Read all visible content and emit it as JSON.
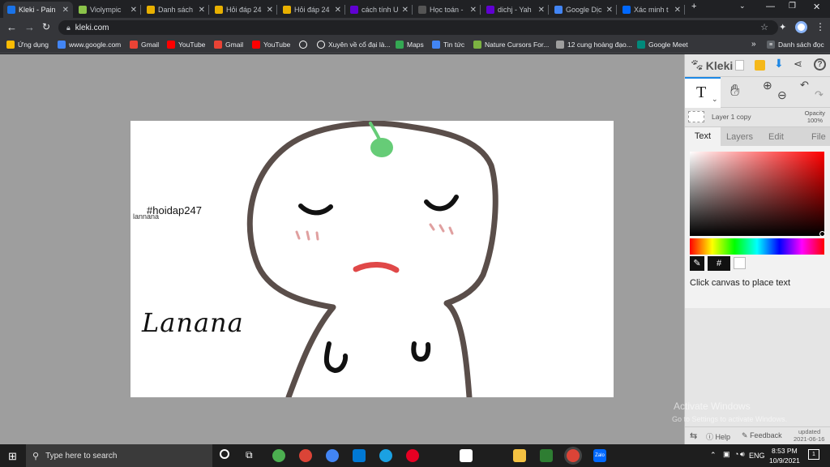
{
  "browser": {
    "tabs": [
      {
        "label": "Kleki - Pain",
        "icon": "kleki-icon",
        "color": "#1a73e8"
      },
      {
        "label": "Violympic",
        "icon": "violympic-icon",
        "color": "#8bc34a"
      },
      {
        "label": "Danh sách",
        "icon": "hoidap-icon",
        "color": "#e8b000"
      },
      {
        "label": "Hỏi đáp 24",
        "icon": "hoidap-icon",
        "color": "#e8b000"
      },
      {
        "label": "Hỏi đáp 24",
        "icon": "hoidap-icon",
        "color": "#e8b000"
      },
      {
        "label": "cách tính U",
        "icon": "yahoo-icon",
        "color": "#6001d2"
      },
      {
        "label": "Học toán -",
        "icon": "hoctoan-icon",
        "color": "#555555"
      },
      {
        "label": "dichj - Yah",
        "icon": "yahoo-icon",
        "color": "#6001d2"
      },
      {
        "label": "Google Dịc",
        "icon": "translate-icon",
        "color": "#4285f4"
      },
      {
        "label": "Xác minh t",
        "icon": "zalo-icon",
        "color": "#0068ff"
      }
    ],
    "url": "kleki.com",
    "bookmarks": [
      {
        "label": "Ứng dụng",
        "icon": "apps-icon",
        "color": "#fbbc04"
      },
      {
        "label": "www.google.com",
        "icon": "google-icon",
        "color": "#4285f4"
      },
      {
        "label": "Gmail",
        "icon": "gmail-icon",
        "color": "#ea4335"
      },
      {
        "label": "YouTube",
        "icon": "youtube-icon",
        "color": "#ff0000"
      },
      {
        "label": "Gmail",
        "icon": "gmail-icon",
        "color": "#ea4335"
      },
      {
        "label": "YouTube",
        "icon": "youtube-icon",
        "color": "#ff0000"
      },
      {
        "label": "",
        "icon": "globe-icon",
        "color": "#ffffff"
      },
      {
        "label": "Xuyên về cổ đại là...",
        "icon": "globe-icon",
        "color": "#ffffff"
      },
      {
        "label": "Maps",
        "icon": "maps-icon",
        "color": "#34a853"
      },
      {
        "label": "Tin tức",
        "icon": "news-icon",
        "color": "#4285f4"
      },
      {
        "label": "Nature Cursors For...",
        "icon": "cursor-icon",
        "color": "#7cb342"
      },
      {
        "label": "12 cung hoàng đạo...",
        "icon": "zodiac-icon",
        "color": "#9e9e9e"
      },
      {
        "label": "Google Meet",
        "icon": "meet-icon",
        "color": "#00897b"
      }
    ],
    "bookmarks_more": "Danh sách đọc"
  },
  "canvas": {
    "hashtag": "#hoidap247",
    "small_signature": "lannana",
    "signature": "Lanana"
  },
  "kleki": {
    "logo": "Kleki",
    "tool_label": "T",
    "layer_name": "Layer 1 copy",
    "opacity_label": "Opacity",
    "opacity_value": "100%",
    "tabs": [
      "Text",
      "Layers",
      "Edit",
      "File"
    ],
    "active_tab": "Text",
    "hex_label": "#",
    "hint": "Click canvas to place text",
    "help": "Help",
    "feedback": "Feedback",
    "updated_label": "updated",
    "updated_date": "2021-06-16"
  },
  "watermark": {
    "line1": "Activate Windows",
    "line2": "Go to Settings to activate Windows."
  },
  "taskbar": {
    "search_placeholder": "Type here to search",
    "language": "ENG",
    "time": "8:53 PM",
    "date": "10/9/2021",
    "notifications": "1"
  }
}
